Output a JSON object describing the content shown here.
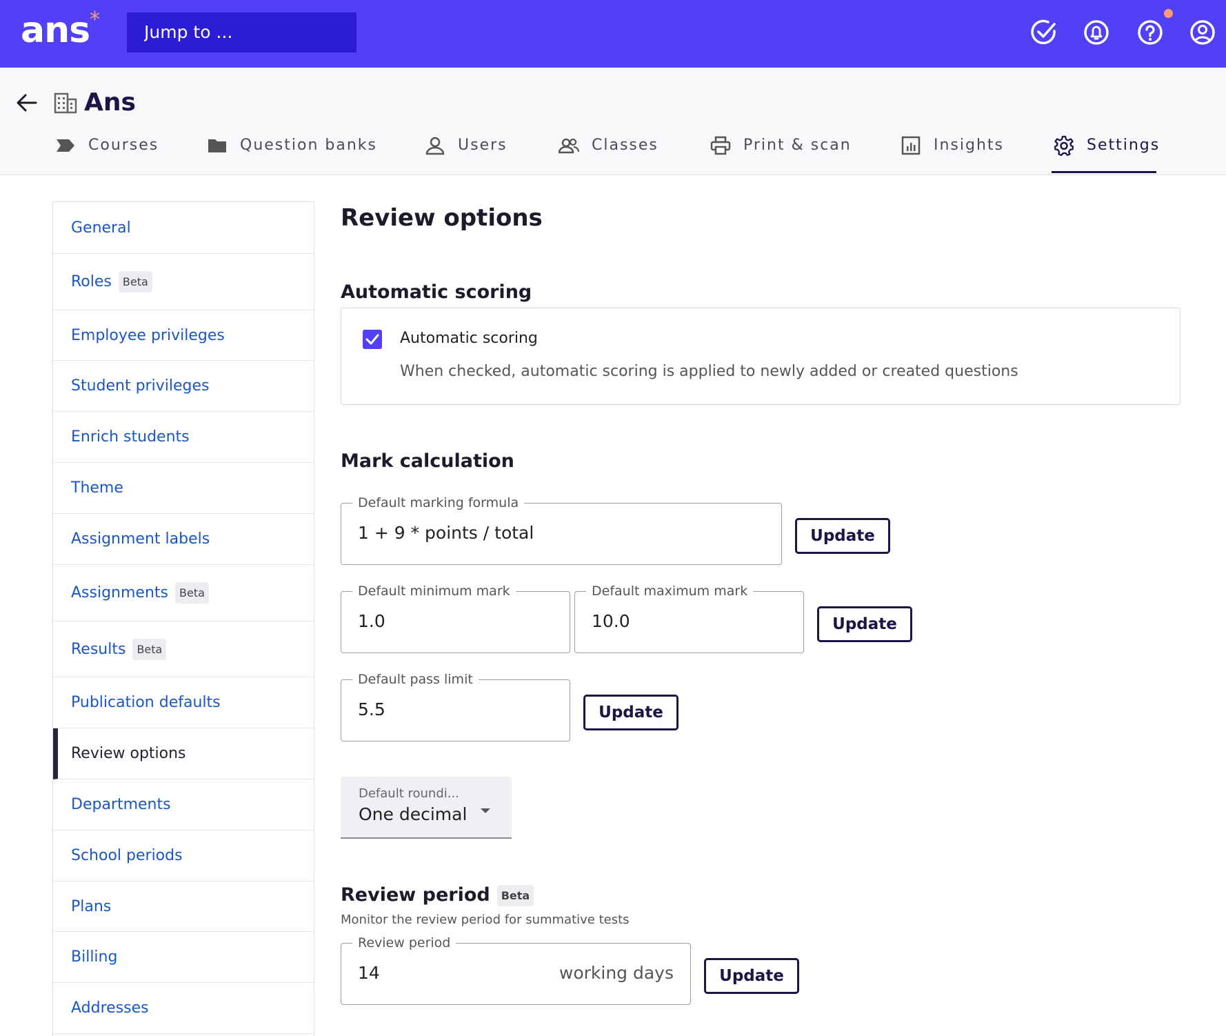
{
  "topbar": {
    "logo": "ans",
    "logo_mark": "*",
    "search_placeholder": "Jump to ...",
    "icons": [
      "check-circle-icon",
      "bell-icon",
      "help-icon",
      "user-icon"
    ],
    "brand_color": "#5140f5",
    "accent_color": "#ff9a76"
  },
  "header": {
    "org_name": "Ans",
    "tabs": [
      {
        "label": "Courses",
        "icon": "courses-icon"
      },
      {
        "label": "Question banks",
        "icon": "folder-icon"
      },
      {
        "label": "Users",
        "icon": "user-icon"
      },
      {
        "label": "Classes",
        "icon": "group-icon"
      },
      {
        "label": "Print & scan",
        "icon": "printer-icon"
      },
      {
        "label": "Insights",
        "icon": "chart-icon"
      },
      {
        "label": "Settings",
        "icon": "gear-icon",
        "active": true
      }
    ]
  },
  "sidebar": {
    "items": [
      {
        "label": "General"
      },
      {
        "label": "Roles",
        "badge": "Beta"
      },
      {
        "label": "Employee privileges"
      },
      {
        "label": "Student privileges"
      },
      {
        "label": "Enrich students"
      },
      {
        "label": "Theme"
      },
      {
        "label": "Assignment labels"
      },
      {
        "label": "Assignments",
        "badge": "Beta"
      },
      {
        "label": "Results",
        "badge": "Beta"
      },
      {
        "label": "Publication defaults"
      },
      {
        "label": "Review options",
        "active": true
      },
      {
        "label": "Departments"
      },
      {
        "label": "School periods"
      },
      {
        "label": "Plans"
      },
      {
        "label": "Billing"
      },
      {
        "label": "Addresses"
      }
    ]
  },
  "main": {
    "title": "Review options",
    "automatic_scoring": {
      "section_title": "Automatic scoring",
      "checkbox_label": "Automatic scoring",
      "checked": true,
      "description": "When checked, automatic scoring is applied to newly added or created questions"
    },
    "mark_calculation": {
      "section_title": "Mark calculation",
      "formula_label": "Default marking formula",
      "formula_value": "1 + 9 * points / total",
      "min_label": "Default minimum mark",
      "min_value": "1.0",
      "max_label": "Default maximum mark",
      "max_value": "10.0",
      "pass_label": "Default pass limit",
      "pass_value": "5.5",
      "rounding_label": "Default roundi...",
      "rounding_value": "One decimal",
      "update_label": "Update"
    },
    "review_period": {
      "section_title": "Review period",
      "badge": "Beta",
      "subtitle": "Monitor the review period for summative tests",
      "field_label": "Review period",
      "field_value": "14",
      "field_suffix": "working days",
      "update_label": "Update"
    }
  }
}
